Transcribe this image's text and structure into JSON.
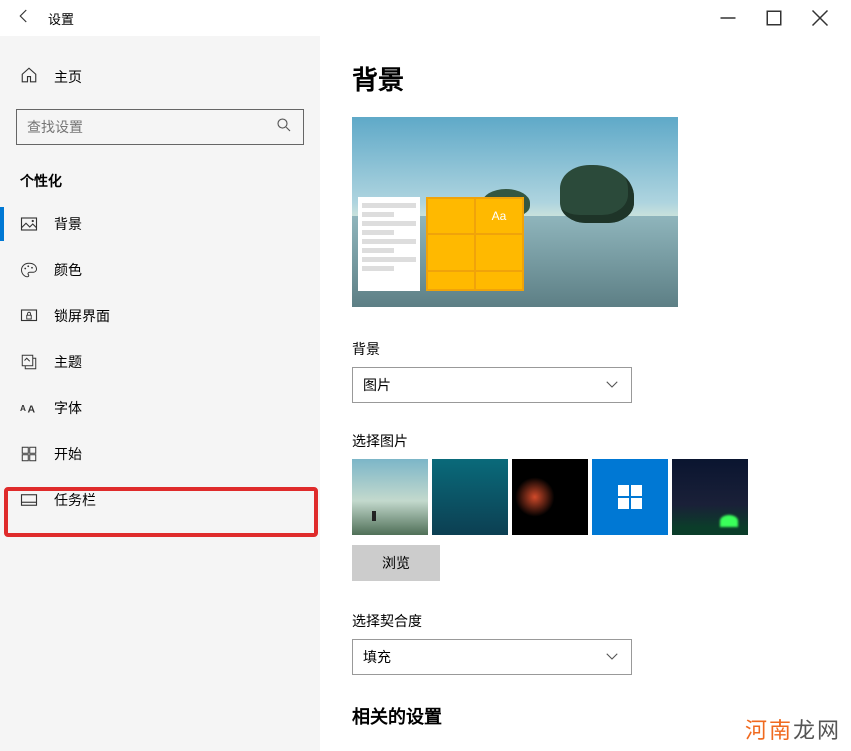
{
  "titlebar": {
    "title": "设置"
  },
  "sidebar": {
    "home_label": "主页",
    "search_placeholder": "查找设置",
    "section_label": "个性化",
    "items": [
      {
        "label": "背景"
      },
      {
        "label": "颜色"
      },
      {
        "label": "锁屏界面"
      },
      {
        "label": "主题"
      },
      {
        "label": "字体"
      },
      {
        "label": "开始"
      },
      {
        "label": "任务栏"
      }
    ]
  },
  "main": {
    "heading": "背景",
    "bg_label": "背景",
    "bg_value": "图片",
    "choose_image_label": "选择图片",
    "browse_label": "浏览",
    "fit_label": "选择契合度",
    "fit_value": "填充",
    "related_heading": "相关的设置",
    "preview_aa": "Aa"
  },
  "watermark": {
    "a": "河南",
    "b": "龙网"
  }
}
